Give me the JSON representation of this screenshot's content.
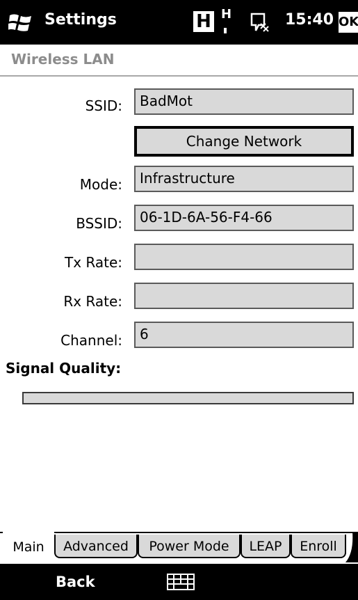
{
  "status_bar": {
    "title": "Settings",
    "network_letter": "H",
    "signal_letter": "H",
    "time": "15:40",
    "ok_label": "OK"
  },
  "header": {
    "title": "Wireless LAN"
  },
  "form": {
    "ssid": {
      "label": "SSID:",
      "value": "BadMot"
    },
    "change_network_label": "Change Network",
    "mode": {
      "label": "Mode:",
      "value": "Infrastructure"
    },
    "bssid": {
      "label": "BSSID:",
      "value": "06-1D-6A-56-F4-66"
    },
    "tx_rate": {
      "label": "Tx Rate:",
      "value": ""
    },
    "rx_rate": {
      "label": "Rx Rate:",
      "value": ""
    },
    "channel": {
      "label": "Channel:",
      "value": "6"
    }
  },
  "signal": {
    "label": "Signal Quality:",
    "level": 0
  },
  "tabs": [
    {
      "label": "Main",
      "active": true
    },
    {
      "label": "Advanced",
      "active": false
    },
    {
      "label": "Power Mode",
      "active": false
    },
    {
      "label": "LEAP",
      "active": false
    },
    {
      "label": "Enroll",
      "active": false
    }
  ],
  "bottom_bar": {
    "left_softkey": "Back",
    "center_icon": "keyboard-icon"
  },
  "colors": {
    "bar": "#000000",
    "field_bg": "#d9d9d9",
    "header_text": "#8c8c8c"
  }
}
